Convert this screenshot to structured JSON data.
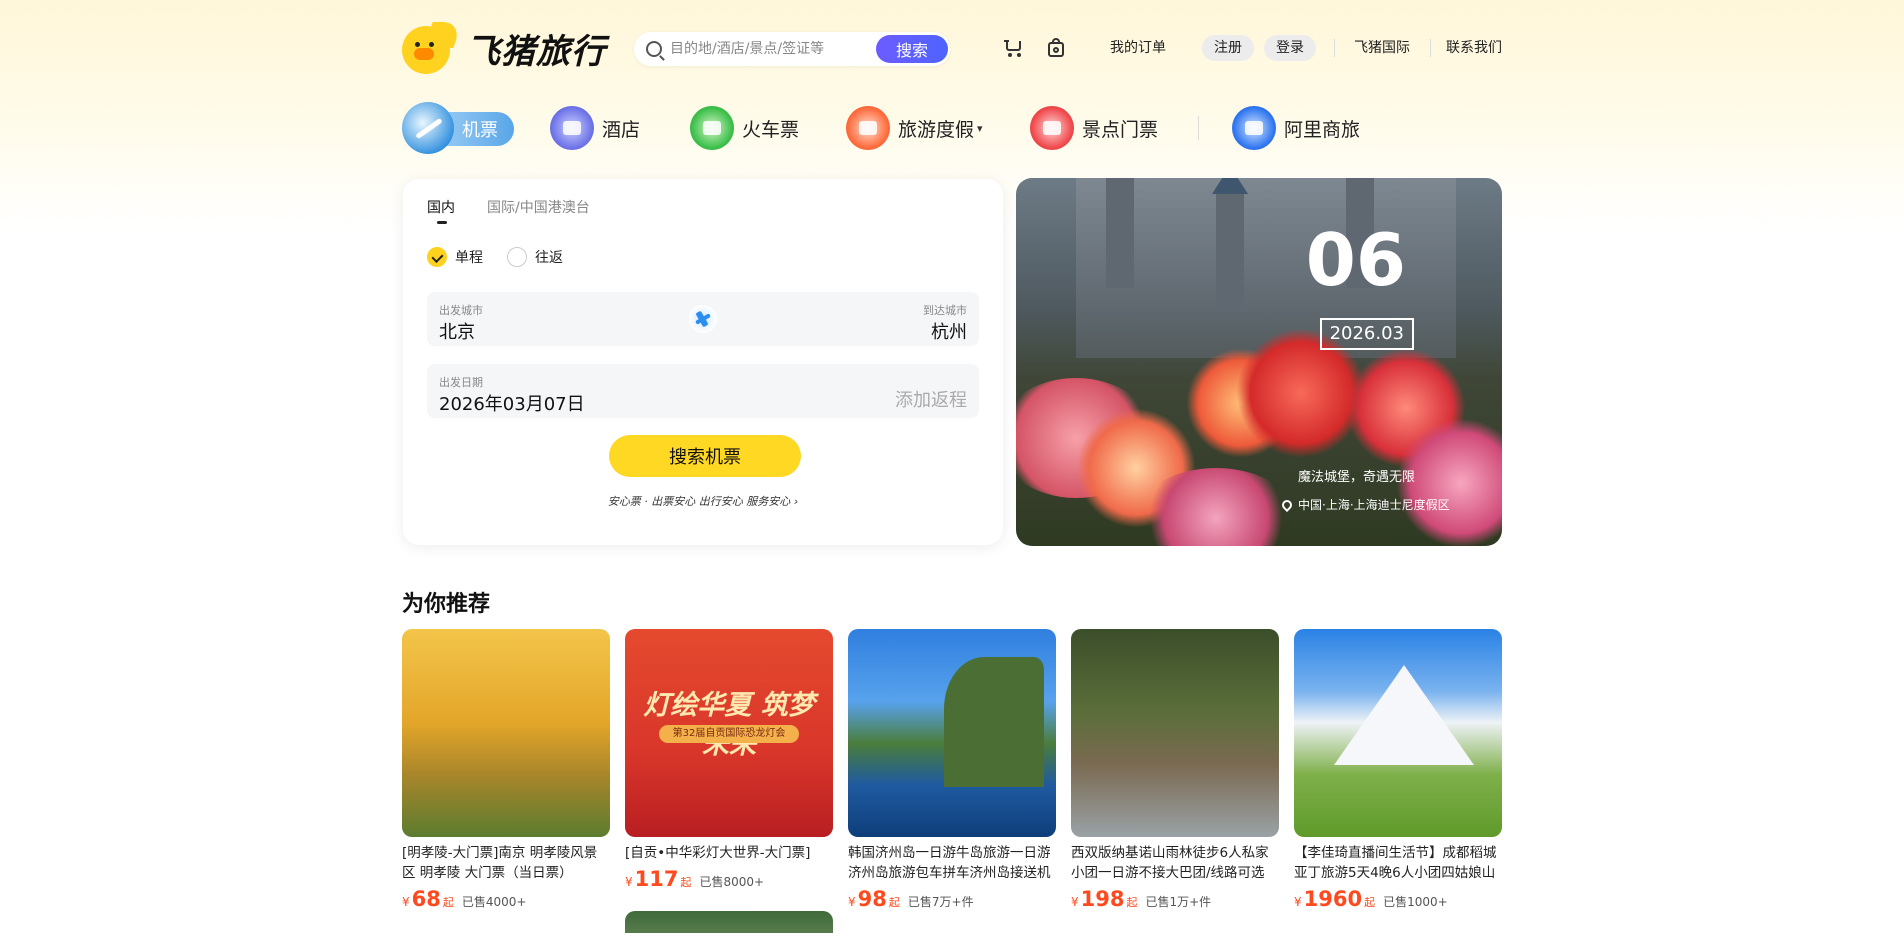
{
  "brand": {
    "name": "飞猪旅行"
  },
  "search": {
    "placeholder": "目的地/酒店/景点/签证等",
    "button": "搜索"
  },
  "header": {
    "icons": [
      "cart-icon",
      "bag-icon"
    ],
    "my_orders": "我的订单",
    "register": "注册",
    "login": "登录",
    "intl": "飞猪国际",
    "contact": "联系我们"
  },
  "nav": {
    "items": [
      {
        "label": "机票",
        "icon": "plane-icon",
        "active": true
      },
      {
        "label": "酒店",
        "icon": "hotel-icon"
      },
      {
        "label": "火车票",
        "icon": "train-icon"
      },
      {
        "label": "旅游度假",
        "icon": "vacation-icon",
        "dropdown": true
      },
      {
        "label": "景点门票",
        "icon": "ticket-icon"
      },
      {
        "label": "阿里商旅",
        "icon": "ali-business-icon"
      }
    ]
  },
  "booking": {
    "tabs": [
      "国内",
      "国际/中国港澳台"
    ],
    "trip_types": [
      {
        "label": "单程",
        "selected": true
      },
      {
        "label": "往返",
        "selected": false
      }
    ],
    "from_label": "出发城市",
    "from_value": "北京",
    "to_label": "到达城市",
    "to_value": "杭州",
    "date_label": "出发日期",
    "date_value": "2026年03月07日",
    "add_return": "添加返程",
    "search_button": "搜索机票",
    "assurance": "安心票 · 出票安心 出行安心 服务安心 ›"
  },
  "banner": {
    "day": "06",
    "month": "2026.03",
    "title": "魔法城堡，奇遇无限",
    "location": "中国·上海·上海迪士尼度假区"
  },
  "recommend": {
    "title": "为你推荐",
    "currency": "¥",
    "from_suffix": "起",
    "items": [
      {
        "name": "[明孝陵-大门票]南京 明孝陵风景区 明孝陵 大门票（当日票）",
        "price": "68",
        "sold": "已售4000+"
      },
      {
        "name": "[自贡•中华彩灯大世界-大门票]",
        "price": "117",
        "sold": "已售8000+",
        "poster_title": "灯绘华夏 筑梦未来",
        "poster_sub": "第32届自贡国际恐龙灯会"
      },
      {
        "name": "韩国济州岛一日游牛岛旅游一日游济州岛旅游包车拼车济州岛接送机",
        "price": "98",
        "sold": "已售7万+件"
      },
      {
        "name": "西双版纳基诺山雨林徒步6人私家小团一日游不接大巴团/线路可选",
        "price": "198",
        "sold": "已售1万+件"
      },
      {
        "name": "【李佳琦直播间生活节】成都稻城亚丁旅游5天4晚6人小团四姑娘山",
        "price": "1960",
        "sold": "已售1000+"
      }
    ]
  },
  "colors": {
    "accent_yellow": "#ffd823",
    "search_purple": "#5b5ff6",
    "price_red": "#ff4a1f"
  }
}
